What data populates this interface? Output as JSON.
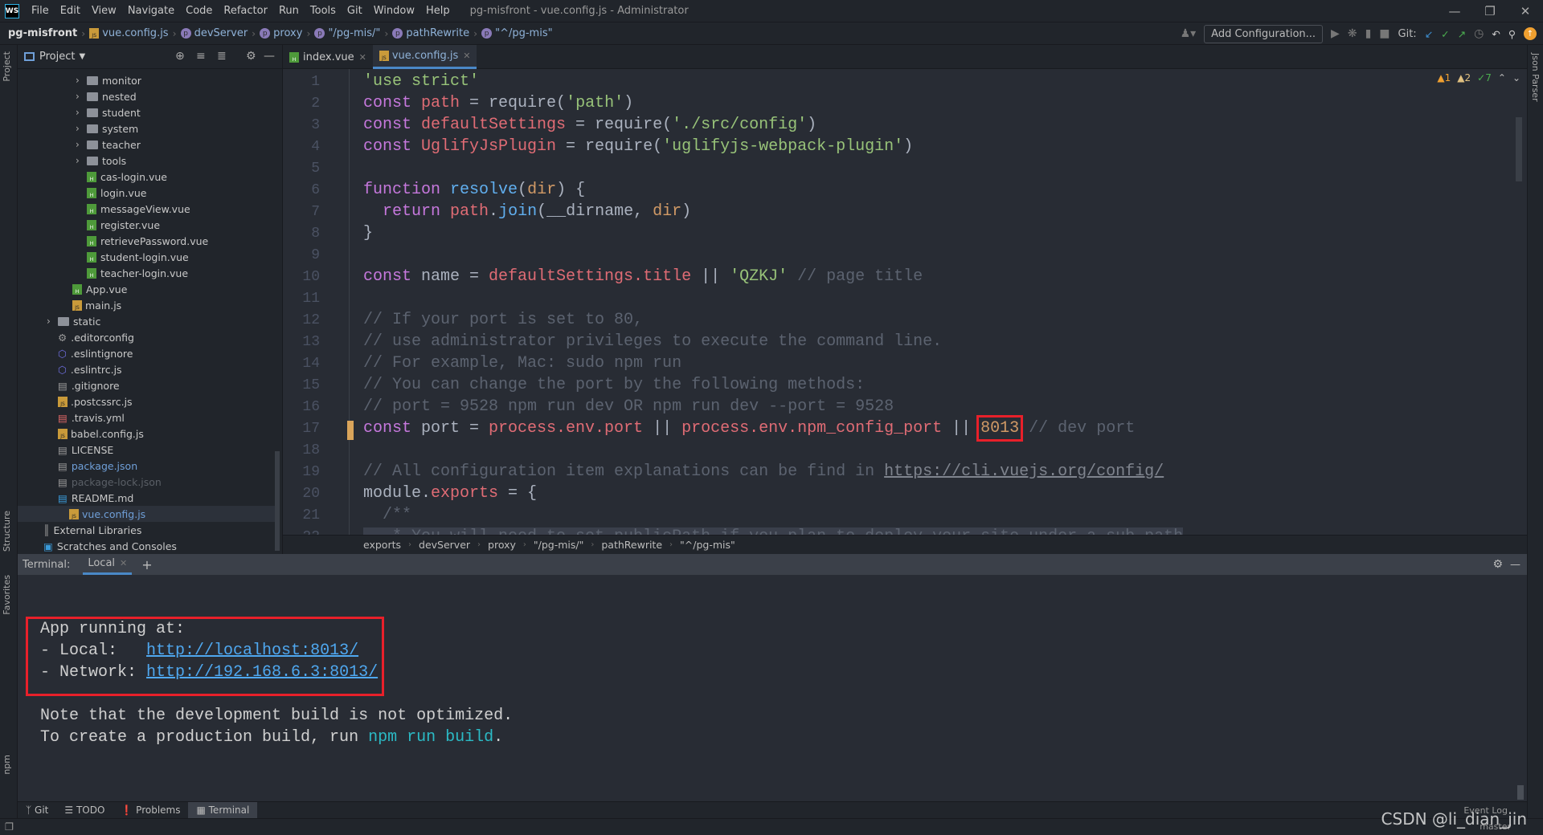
{
  "window": {
    "title": "pg-misfront - vue.config.js - Administrator",
    "logo": "WS"
  },
  "menu": [
    "File",
    "Edit",
    "View",
    "Navigate",
    "Code",
    "Refactor",
    "Run",
    "Tools",
    "Git",
    "Window",
    "Help"
  ],
  "navbar": {
    "root": "pg-misfront",
    "crumbs": [
      "vue.config.js",
      "devServer",
      "proxy",
      "\"/pg-mis/\"",
      "pathRewrite",
      "\"^/pg-mis\""
    ],
    "add_config": "Add Configuration...",
    "git_label": "Git:"
  },
  "project": {
    "title": "Project",
    "items": [
      {
        "label": "monitor",
        "type": "folder",
        "depth": 3
      },
      {
        "label": "nested",
        "type": "folder",
        "depth": 3
      },
      {
        "label": "student",
        "type": "folder",
        "depth": 3
      },
      {
        "label": "system",
        "type": "folder",
        "depth": 3
      },
      {
        "label": "teacher",
        "type": "folder",
        "depth": 3
      },
      {
        "label": "tools",
        "type": "folder",
        "depth": 3
      },
      {
        "label": "cas-login.vue",
        "type": "vue",
        "depth": 3
      },
      {
        "label": "login.vue",
        "type": "vue",
        "depth": 3
      },
      {
        "label": "messageView.vue",
        "type": "vue",
        "depth": 3
      },
      {
        "label": "register.vue",
        "type": "vue",
        "depth": 3
      },
      {
        "label": "retrievePassword.vue",
        "type": "vue",
        "depth": 3
      },
      {
        "label": "student-login.vue",
        "type": "vue",
        "depth": 3
      },
      {
        "label": "teacher-login.vue",
        "type": "vue",
        "depth": 3
      },
      {
        "label": "App.vue",
        "type": "vue",
        "depth": 2
      },
      {
        "label": "main.js",
        "type": "js",
        "depth": 2
      },
      {
        "label": "static",
        "type": "folder",
        "depth": 1
      },
      {
        "label": ".editorconfig",
        "type": "gear",
        "depth": 1
      },
      {
        "label": ".eslintignore",
        "type": "eslint",
        "depth": 1
      },
      {
        "label": ".eslintrc.js",
        "type": "eslint",
        "depth": 1
      },
      {
        "label": ".gitignore",
        "type": "file",
        "depth": 1
      },
      {
        "label": ".postcssrc.js",
        "type": "js",
        "depth": 1
      },
      {
        "label": ".travis.yml",
        "type": "yml",
        "depth": 1
      },
      {
        "label": "babel.config.js",
        "type": "js",
        "depth": 1
      },
      {
        "label": "LICENSE",
        "type": "file",
        "depth": 1
      },
      {
        "label": "package.json",
        "type": "json",
        "depth": 1,
        "color": "#6f9fd8"
      },
      {
        "label": "package-lock.json",
        "type": "json",
        "depth": 1,
        "color": "#5a5f66"
      },
      {
        "label": "README.md",
        "type": "md",
        "depth": 1
      },
      {
        "label": "vue.config.js",
        "type": "js",
        "depth": 1,
        "color": "#6f9fd8",
        "selected": true
      },
      {
        "label": "External Libraries",
        "type": "lib",
        "depth": 0
      },
      {
        "label": "Scratches and Consoles",
        "type": "scratch",
        "depth": 0
      }
    ]
  },
  "tabs": [
    {
      "label": "index.vue",
      "active": false
    },
    {
      "label": "vue.config.js",
      "active": true
    }
  ],
  "inspections": {
    "warnings": "1",
    "weak": "2",
    "typos": "7"
  },
  "code": [
    [
      [
        "'use strict'",
        "str"
      ]
    ],
    [
      [
        "const ",
        "kw"
      ],
      [
        "path",
        "var"
      ],
      [
        " = require(",
        "plain"
      ],
      [
        "'path'",
        "str"
      ],
      [
        ")",
        "plain"
      ]
    ],
    [
      [
        "const ",
        "kw"
      ],
      [
        "defaultSettings",
        "var"
      ],
      [
        " = require(",
        "plain"
      ],
      [
        "'./src/config'",
        "str"
      ],
      [
        ")",
        "plain"
      ]
    ],
    [
      [
        "const ",
        "kw"
      ],
      [
        "UglifyJsPlugin",
        "var"
      ],
      [
        " = require(",
        "plain"
      ],
      [
        "'uglifyjs-webpack-plugin'",
        "str"
      ],
      [
        ")",
        "plain"
      ]
    ],
    [],
    [
      [
        "function ",
        "kw"
      ],
      [
        "resolve",
        "fn"
      ],
      [
        "(",
        "plain"
      ],
      [
        "dir",
        "param"
      ],
      [
        ") {",
        "plain"
      ]
    ],
    [
      [
        "  return ",
        "kw"
      ],
      [
        "path",
        "var"
      ],
      [
        ".",
        "plain"
      ],
      [
        "join",
        "fn"
      ],
      [
        "(__dirname, ",
        "plain"
      ],
      [
        "dir",
        "param"
      ],
      [
        ")",
        "plain"
      ]
    ],
    [
      [
        "}",
        "plain"
      ]
    ],
    [],
    [
      [
        "const ",
        "kw"
      ],
      [
        "name = ",
        "plain"
      ],
      [
        "defaultSettings.title",
        "var"
      ],
      [
        " || ",
        "plain"
      ],
      [
        "'QZKJ'",
        "str"
      ],
      [
        " // page title",
        "cm"
      ]
    ],
    [],
    [
      [
        "// If your port is set to 80,",
        "cm"
      ]
    ],
    [
      [
        "// use administrator privileges to execute the command line.",
        "cm"
      ]
    ],
    [
      [
        "// For example, Mac: sudo npm run",
        "cm"
      ]
    ],
    [
      [
        "// You can change the port by the following methods:",
        "cm"
      ]
    ],
    [
      [
        "// port = 9528 npm run dev OR npm run dev --port = 9528",
        "cm"
      ]
    ],
    [
      [
        "const ",
        "kw"
      ],
      [
        "port = ",
        "plain"
      ],
      [
        "process.env.port",
        "var"
      ],
      [
        " || ",
        "plain"
      ],
      [
        "process.env.npm_config_port",
        "var"
      ],
      [
        " || ",
        "plain"
      ],
      [
        "8013",
        "num hl"
      ],
      [
        " // dev port",
        "cm"
      ]
    ],
    [],
    [
      [
        "// All configuration item explanations can be find in ",
        "cm"
      ],
      [
        "https://cli.vuejs.org/config/",
        "cm link"
      ]
    ],
    [
      [
        "module",
        "plain"
      ],
      [
        ".",
        "plain"
      ],
      [
        "exports",
        "var"
      ],
      [
        " = {",
        "plain"
      ]
    ],
    [
      [
        "  /**",
        "cm"
      ]
    ],
    [
      [
        "   * You will need to set publicPath if you plan to deploy your site under a sub path",
        "cm"
      ]
    ]
  ],
  "editor_breadcrumbs": [
    "exports",
    "devServer",
    "proxy",
    "\"/pg-mis/\"",
    "pathRewrite",
    "\"^/pg-mis\""
  ],
  "terminal": {
    "label": "Terminal:",
    "tab": "Local",
    "app_running": "App running at:",
    "local_label": "- Local:   ",
    "local_url": "http://localhost:8013/",
    "network_label": "- Network: ",
    "network_url": "http://192.168.6.3:8013/",
    "note": "Note that the development build is not optimized.",
    "create_prefix": "To create a production build, run ",
    "create_cmd": "npm run build",
    "create_suffix": "."
  },
  "bottom_tools": [
    "Git",
    "TODO",
    "Problems",
    "Terminal"
  ],
  "side_tabs": {
    "left": [
      "Project",
      "Structure",
      "Favorites",
      "npm"
    ],
    "right": [
      "Json Parser"
    ]
  },
  "status": {
    "event_log": "Event Log",
    "branch": "master"
  },
  "watermark": "CSDN @li_dian_jin"
}
